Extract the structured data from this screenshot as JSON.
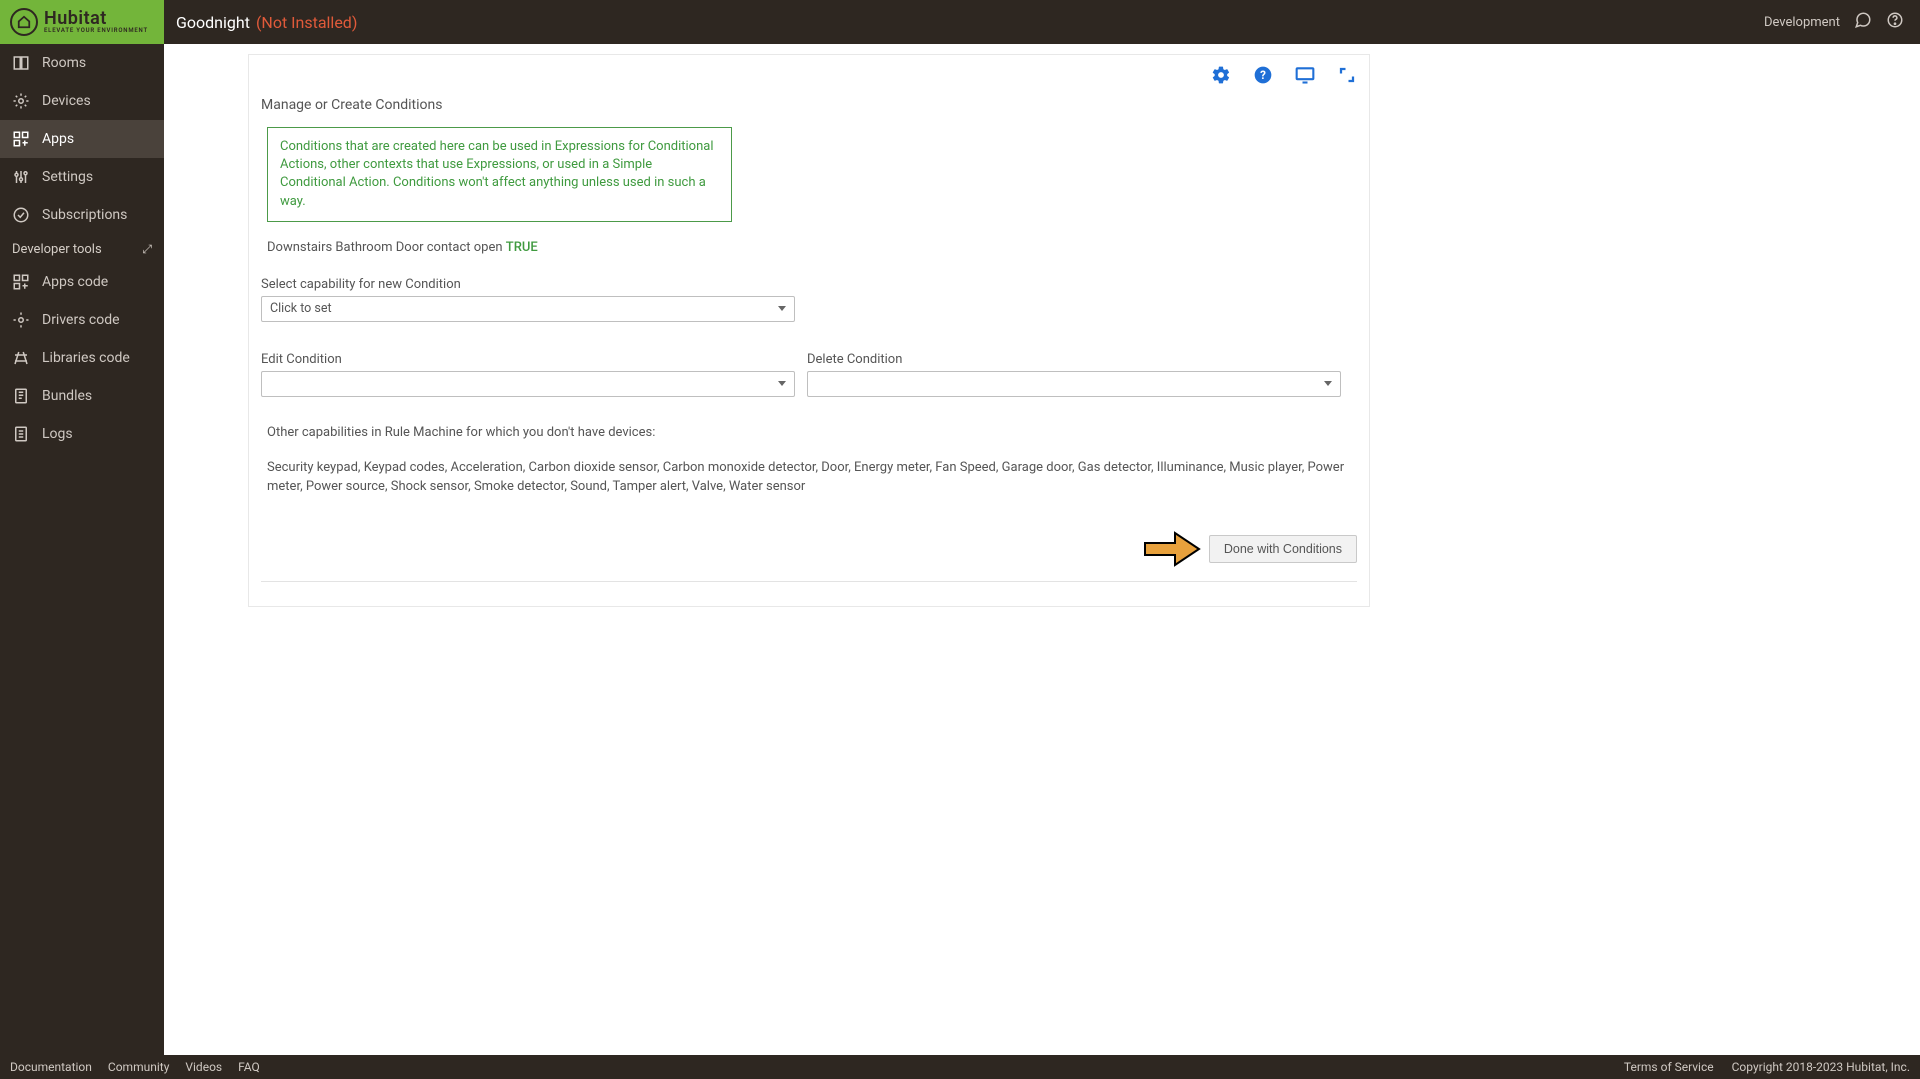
{
  "header": {
    "app_title": "Goodnight",
    "status": "(Not Installed)",
    "env_label": "Development",
    "brand": "Hubitat",
    "tagline": "ELEVATE YOUR ENVIRONMENT"
  },
  "sidebar": {
    "items": [
      {
        "label": "Rooms"
      },
      {
        "label": "Devices"
      },
      {
        "label": "Apps"
      },
      {
        "label": "Settings"
      },
      {
        "label": "Subscriptions"
      }
    ],
    "dev_section": "Developer tools",
    "dev_items": [
      {
        "label": "Apps code"
      },
      {
        "label": "Drivers code"
      },
      {
        "label": "Libraries code"
      },
      {
        "label": "Bundles"
      },
      {
        "label": "Logs"
      }
    ]
  },
  "main": {
    "title": "Manage or Create Conditions",
    "info": "Conditions that are created here can be used in Expressions for Conditional Actions, other contexts that use Expressions, or used in a Simple Conditional Action.  Conditions won't affect anything unless used in such a way.",
    "condition_text": "Downstairs Bathroom Door contact open",
    "condition_status": "TRUE",
    "select_capability_label": "Select capability for new Condition",
    "select_capability_value": "Click to set",
    "edit_label": "Edit Condition",
    "edit_value": "",
    "delete_label": "Delete Condition",
    "delete_value": "",
    "other_caps_label": "Other capabilities in Rule Machine for which you don't have devices:",
    "other_caps_list": "Security keypad, Keypad codes, Acceleration, Carbon dioxide sensor, Carbon monoxide detector, Door, Energy meter, Fan Speed, Garage door, Gas detector, Illuminance, Music player, Power meter, Power source, Shock sensor, Smoke detector, Sound, Tamper alert, Valve, Water sensor",
    "done_button": "Done with Conditions"
  },
  "footer": {
    "links": [
      "Documentation",
      "Community",
      "Videos",
      "FAQ"
    ],
    "terms": "Terms of Service",
    "copyright": "Copyright 2018-2023 Hubitat, Inc."
  }
}
